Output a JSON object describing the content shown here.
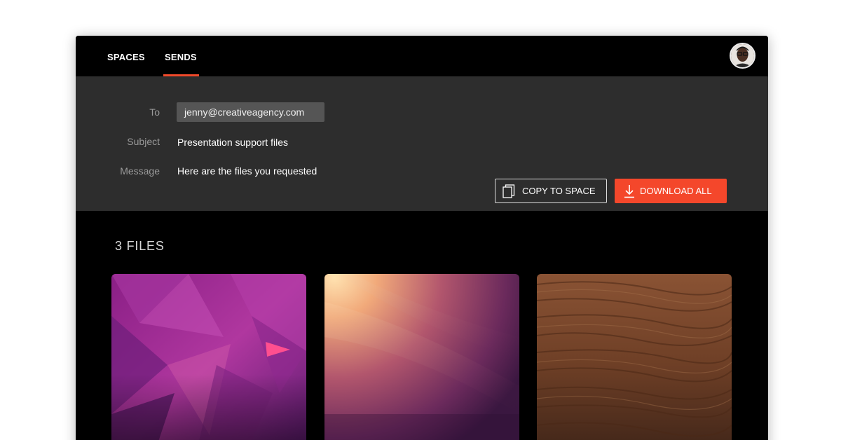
{
  "nav": {
    "tabs": [
      {
        "label": "SPACES",
        "active": false
      },
      {
        "label": "SENDS",
        "active": true
      }
    ],
    "accent_color": "#f0492a"
  },
  "send": {
    "to_label": "To",
    "to_value": "jenny@creativeagency.com",
    "subject_label": "Subject",
    "subject_value": "Presentation support files",
    "message_label": "Message",
    "message_value": "Here are the files you requested"
  },
  "actions": {
    "copy_label": "COPY TO SPACE",
    "copy_icon": "copy-icon",
    "download_label": "DOWNLOAD ALL",
    "download_icon": "download-icon",
    "download_color": "#f4472b"
  },
  "files": {
    "count_label": "3 FILES",
    "items": [
      {
        "kind": "image",
        "style": "purple-geometric"
      },
      {
        "kind": "image",
        "style": "sunset-gradient"
      },
      {
        "kind": "image",
        "style": "wood-texture"
      }
    ]
  }
}
